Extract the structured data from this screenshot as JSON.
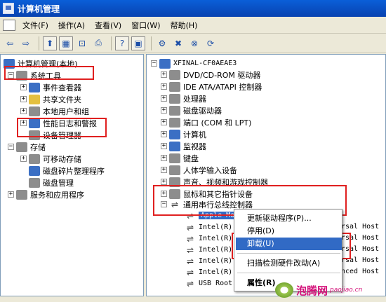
{
  "window": {
    "title": "计算机管理"
  },
  "menu": [
    "文件(F)",
    "操作(A)",
    "查看(V)",
    "窗口(W)",
    "帮助(H)"
  ],
  "toolbar": {
    "back": "⇦",
    "forward": "⇨",
    "up": "⬆",
    "tree": "▦",
    "props": "⊡",
    "print": "⎙",
    "help": "?",
    "pane": "▣",
    "scan": "⚙",
    "uninstall": "✖",
    "disable": "⊗",
    "update": "⟳"
  },
  "left_tree": {
    "root": "计算机管理(本地)",
    "system_tools": "系统工具",
    "event_viewer": "事件查看器",
    "shared_folders": "共享文件夹",
    "local_users": "本地用户和组",
    "perf_logs": "性能日志和警报",
    "device_manager": "设备管理器",
    "storage": "存储",
    "removable": "可移动存储",
    "defrag": "磁盘碎片整理程序",
    "disk_mgmt": "磁盘管理",
    "services": "服务和应用程序"
  },
  "right_tree": {
    "computer": "XFINAL-CF0AEAE3",
    "categories": [
      "DVD/CD-ROM 驱动器",
      "IDE ATA/ATAPI 控制器",
      "处理器",
      "磁盘驱动器",
      "端口 (COM 和 LPT)",
      "计算机",
      "监视器",
      "键盘",
      "人体学输入设备",
      "声音、视频和游戏控制器",
      "鼠标和其它指针设备",
      "通用串行总线控制器"
    ],
    "usb_children": [
      "Apple Mobile Device USB Driver",
      "Intel(R)",
      "Intel(R)",
      "Intel(R)",
      "Intel(R)",
      "Intel(R)",
      "USB Root"
    ],
    "overflow": [
      "rsal Host",
      "rsal Host",
      "rsal Host",
      "rsal Host",
      "nced Host"
    ]
  },
  "context_menu": {
    "update_driver": "更新驱动程序(P)...",
    "disable": "停用(D)",
    "uninstall": "卸载(U)",
    "scan": "扫描检测硬件改动(A)",
    "properties": "属性(R)"
  },
  "watermark": {
    "brand": "泡腾网",
    "url": "paojiao.cn"
  },
  "colors": {
    "highlight": "#316ac5",
    "annotation": "#e02020",
    "titlebar": "#0a5fd8"
  }
}
